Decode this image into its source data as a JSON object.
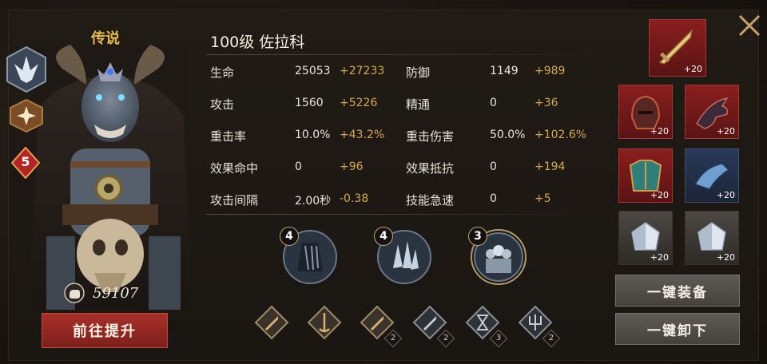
{
  "hero": {
    "rarity": "传说",
    "level_badge": "5",
    "power": "59107",
    "upgrade_label": "前往提升",
    "name": "100级  佐拉科"
  },
  "stats": [
    {
      "left_name": "生命",
      "left_base": "25053",
      "left_bonus": "+27233",
      "right_name": "防御",
      "right_base": "1149",
      "right_bonus": "+989"
    },
    {
      "left_name": "攻击",
      "left_base": "1560",
      "left_bonus": "+5226",
      "right_name": "精通",
      "right_base": "0",
      "right_bonus": "+36"
    },
    {
      "left_name": "重击率",
      "left_base": "10.0%",
      "left_bonus": "+43.2%",
      "right_name": "重击伤害",
      "right_base": "50.0%",
      "right_bonus": "+102.6%"
    },
    {
      "left_name": "效果命中",
      "left_base": "0",
      "left_bonus": "+96",
      "right_name": "效果抵抗",
      "right_base": "0",
      "right_bonus": "+194"
    },
    {
      "left_name": "攻击间隔",
      "left_base": "2.00秒",
      "left_bonus": "-0.38",
      "right_name": "技能急速",
      "right_base": "0",
      "right_bonus": "+5"
    }
  ],
  "sets": [
    {
      "count": "4",
      "icon": "feather-cloak-icon"
    },
    {
      "count": "4",
      "icon": "crystal-shards-icon"
    },
    {
      "count": "3",
      "icon": "knight-squad-icon"
    }
  ],
  "weapon_types": [
    {
      "icon": "sword-icon",
      "count": ""
    },
    {
      "icon": "staff-icon",
      "count": ""
    },
    {
      "icon": "dagger-icon",
      "count": "2"
    },
    {
      "icon": "blade-icon",
      "count": "2"
    },
    {
      "icon": "hourglass-icon",
      "count": "3"
    },
    {
      "icon": "trident-icon",
      "count": "2"
    }
  ],
  "equipment": {
    "weapon": {
      "plus": "+20",
      "icon": "golden-sword-icon"
    },
    "slots": [
      {
        "plus": "+20",
        "icon": "helmet-icon"
      },
      {
        "plus": "+20",
        "icon": "weapon-claw-icon"
      },
      {
        "plus": "+20",
        "icon": "armor-icon"
      },
      {
        "plus": "+20",
        "icon": "gauntlet-icon"
      },
      {
        "plus": "+20",
        "icon": "gem-icon"
      },
      {
        "plus": "+20",
        "icon": "gem-icon"
      }
    ]
  },
  "actions": {
    "equip_all": "一键装备",
    "unequip_all": "一键卸下"
  },
  "colors": {
    "gold": "#d7a94b",
    "rarity": "#e7b94a",
    "primary_button": "#a9302a",
    "red_slot": "#8a1e1e"
  }
}
